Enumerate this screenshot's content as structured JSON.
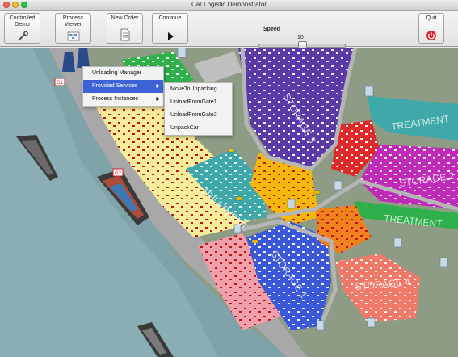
{
  "window": {
    "title": "Car Logistic Demonstrator"
  },
  "toolbar": {
    "controlled_demo": "Controlled Demo",
    "process_viewer": "Process Viewer",
    "new_order": "New Order",
    "continue": "Continue",
    "quit": "Quit"
  },
  "speed": {
    "label": "Speed",
    "value": "10",
    "level_fraction": 0.5
  },
  "map": {
    "area_labels": [
      "STORAGE 3",
      "TREATMENT",
      "STORAGE 2",
      "TREATMENT",
      "STORAGE 1",
      "TREATMENT",
      "STORAGE 4"
    ],
    "gate_labels": [
      "G1",
      "G2"
    ]
  },
  "context_menu": {
    "items": [
      {
        "label": "Unloading Manager",
        "has_submenu": false,
        "active": false
      },
      {
        "label": "Provided Services",
        "has_submenu": true,
        "active": true
      },
      {
        "label": "Process Instances",
        "has_submenu": true,
        "active": false
      }
    ]
  },
  "submenu": {
    "items": [
      "MoveToUnpacking",
      "UnloadFromGate1",
      "UnloadFromGate2",
      "UnpackCar"
    ]
  },
  "colors": {
    "water": "#7fa3a8",
    "road": "#a8a8a8",
    "yellow_zone": "#f4ee9a",
    "pink_zone": "#f0a0a8",
    "purple_zone": "#5a3aa8",
    "blue_zone": "#3b58d8",
    "teal_zone": "#3fa8a8",
    "green_zone": "#2fb04a",
    "orange_zone": "#f0821e",
    "red_zone": "#e02a2a",
    "magenta_zone": "#c02ab8",
    "amber_zone": "#f2b80c",
    "menu_highlight": "#3d62d6"
  }
}
